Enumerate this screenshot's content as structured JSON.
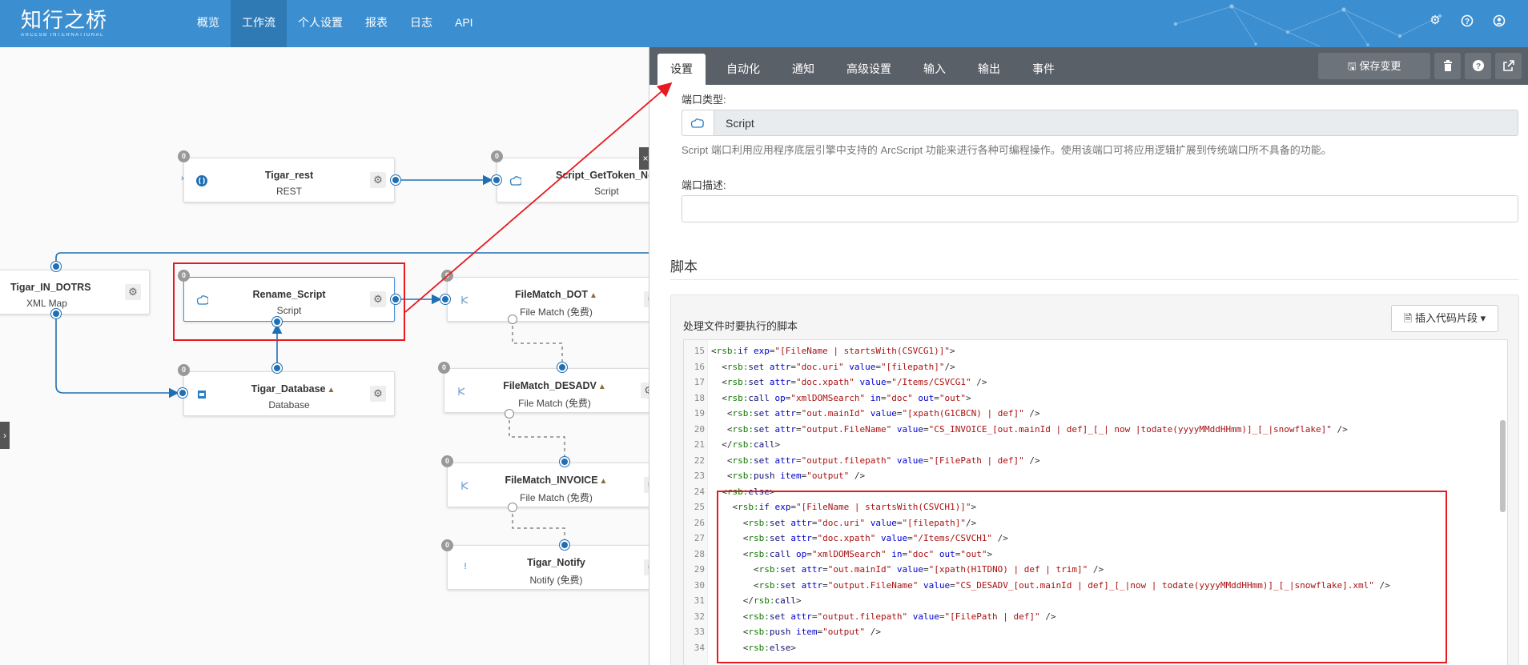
{
  "header": {
    "logo_main": "知行之桥",
    "logo_sub": "ARCESB INTERNATIONAL",
    "nav": [
      {
        "label": "概览",
        "active": false
      },
      {
        "label": "工作流",
        "active": true
      },
      {
        "label": "个人设置",
        "active": false
      },
      {
        "label": "报表",
        "active": false
      },
      {
        "label": "日志",
        "active": false
      },
      {
        "label": "API",
        "active": false
      }
    ],
    "icons": [
      "gear-icon",
      "help-icon",
      "user-icon"
    ],
    "color": "#3b8ed0"
  },
  "canvas": {
    "nodes": [
      {
        "key": "tigar-rest",
        "name": "Tigar_rest",
        "type": "REST",
        "badge": "0",
        "icon": "rest-icon"
      },
      {
        "key": "script-gettoken",
        "name": "Script_GetToken_Ne",
        "type": "Script",
        "badge": "0",
        "icon": "script-icon"
      },
      {
        "key": "tigar-in-dotrs",
        "name": "Tigar_IN_DOTRS",
        "type": "XML Map",
        "badge": "",
        "icon": ""
      },
      {
        "key": "rename-script",
        "name": "Rename_Script",
        "type": "Script",
        "badge": "0",
        "icon": "script-icon"
      },
      {
        "key": "filematch-dot",
        "name": "FileMatch_DOT",
        "type": "File Match (免费)",
        "badge": "0",
        "icon": "filematch-icon",
        "warn": "▲"
      },
      {
        "key": "tigar-database",
        "name": "Tigar_Database",
        "type": "Database",
        "badge": "0",
        "icon": "database-icon",
        "warn": "▲"
      },
      {
        "key": "filematch-desadv",
        "name": "FileMatch_DESADV",
        "type": "File Match (免费)",
        "badge": "0",
        "icon": "filematch-icon",
        "warn": "▲"
      },
      {
        "key": "filematch-invoice",
        "name": "FileMatch_INVOICE",
        "type": "File Match (免费)",
        "badge": "0",
        "icon": "filematch-icon",
        "warn": "▲"
      },
      {
        "key": "tigar-notify",
        "name": "Tigar_Notify",
        "type": "Notify (免费)",
        "badge": "0",
        "icon": "notify-icon"
      }
    ]
  },
  "panel": {
    "tabs": [
      {
        "label": "设置",
        "active": true
      },
      {
        "label": "自动化",
        "active": false
      },
      {
        "label": "通知",
        "active": false
      },
      {
        "label": "高级设置",
        "active": false
      },
      {
        "label": "输入",
        "active": false
      },
      {
        "label": "输出",
        "active": false
      },
      {
        "label": "事件",
        "active": false
      }
    ],
    "save_label": "保存变更",
    "port_type_label": "端口类型:",
    "port_type_value": "Script",
    "port_type_desc": "Script 端口利用应用程序底层引擎中支持的 ArcScript 功能来进行各种可编程操作。使用该端口可将应用逻辑扩展到传统端口所不具备的功能。",
    "port_desc_label": "端口描述:",
    "port_desc_value": "",
    "script_section": "脚本",
    "script_card_title": "处理文件时要执行的脚本",
    "insert_snippet_label": "插入代码片段",
    "code_lines": [
      {
        "no": "15",
        "text": "<rsb:if exp=\"[FileName | startsWith(CSVCG1)]\">"
      },
      {
        "no": "16",
        "text": "  <rsb:set attr=\"doc.uri\" value=\"[filepath]\"/>"
      },
      {
        "no": "17",
        "text": "  <rsb:set attr=\"doc.xpath\" value=\"/Items/CSVCG1\" />"
      },
      {
        "no": "18",
        "text": "  <rsb:call op=\"xmlDOMSearch\" in=\"doc\" out=\"out\">"
      },
      {
        "no": "19",
        "text": "   <rsb:set attr=\"out.mainId\" value=\"[xpath(G1CBCN) | def]\" />"
      },
      {
        "no": "20",
        "text": "   <rsb:set attr=\"output.FileName\" value=\"CS_INVOICE_[out.mainId | def]_[_| now |todate(yyyyMMddHHmm)]_[_|snowflake]\" />"
      },
      {
        "no": "21",
        "text": "  </rsb:call>"
      },
      {
        "no": "22",
        "text": "   <rsb:set attr=\"output.filepath\" value=\"[FilePath | def]\" />"
      },
      {
        "no": "23",
        "text": "   <rsb:push item=\"output\" />"
      },
      {
        "no": "24",
        "text": "  <rsb:else>"
      },
      {
        "no": "25",
        "text": "    <rsb:if exp=\"[FileName | startsWith(CSVCH1)]\">"
      },
      {
        "no": "26",
        "text": "      <rsb:set attr=\"doc.uri\" value=\"[filepath]\"/>"
      },
      {
        "no": "27",
        "text": "      <rsb:set attr=\"doc.xpath\" value=\"/Items/CSVCH1\" />"
      },
      {
        "no": "28",
        "text": "      <rsb:call op=\"xmlDOMSearch\" in=\"doc\" out=\"out\">"
      },
      {
        "no": "29",
        "text": "        <rsb:set attr=\"out.mainId\" value=\"[xpath(H1TDNO) | def | trim]\" />"
      },
      {
        "no": "30",
        "text": "        <rsb:set attr=\"output.FileName\" value=\"CS_DESADV_[out.mainId | def]_[_|now | todate(yyyyMMddHHmm)]_[_|snowflake].xml\" />"
      },
      {
        "no": "31",
        "text": "      </rsb:call>"
      },
      {
        "no": "32",
        "text": "      <rsb:set attr=\"output.filepath\" value=\"[FilePath | def]\" />"
      },
      {
        "no": "33",
        "text": "      <rsb:push item=\"output\" />"
      },
      {
        "no": "34",
        "text": "      <rsb:else>"
      }
    ]
  },
  "annotation_color": "#e8191f"
}
